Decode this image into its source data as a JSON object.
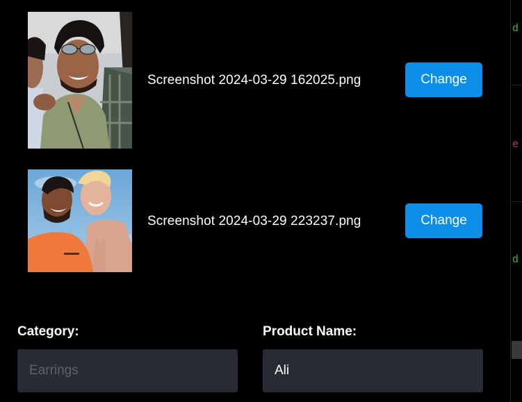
{
  "images": [
    {
      "file_name": "Screenshot 2024-03-29 162025.png",
      "change_label": "Change",
      "photo_icon": "group-selfie-photo"
    },
    {
      "file_name": "Screenshot 2024-03-29 223237.png",
      "change_label": "Change",
      "photo_icon": "beach-selfie-photo"
    }
  ],
  "form": {
    "category": {
      "label": "Category:",
      "placeholder": "Earrings",
      "value": ""
    },
    "product_name": {
      "label": "Product Name:",
      "placeholder": "",
      "value": "Ali"
    }
  },
  "colors": {
    "background": "#000000",
    "button": "#0b8ee8",
    "input_bg": "#272b33",
    "placeholder": "#5d636d",
    "text": "#ffffff"
  }
}
